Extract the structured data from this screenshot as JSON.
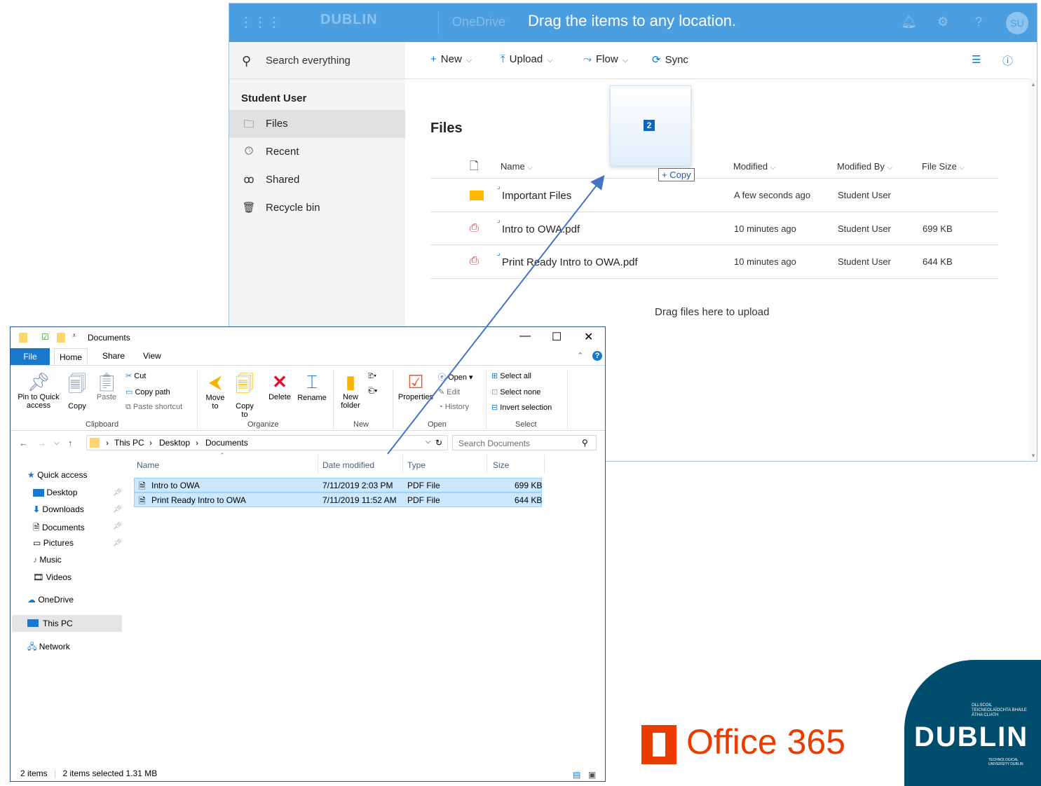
{
  "onedrive": {
    "brand": "DUBLIN",
    "app_name": "OneDrive",
    "message": "Drag the items to any location.",
    "avatar": "SU",
    "search_placeholder": "Search everything",
    "user_name": "Student User",
    "nav": [
      {
        "label": "Files",
        "icon": "folder-icon"
      },
      {
        "label": "Recent",
        "icon": "clock-icon"
      },
      {
        "label": "Shared",
        "icon": "people-icon"
      },
      {
        "label": "Recycle bin",
        "icon": "recycle-bin-icon"
      }
    ],
    "commands": {
      "new": "New",
      "upload": "Upload",
      "flow": "Flow",
      "sync": "Sync"
    },
    "files_title": "Files",
    "columns": {
      "name": "Name",
      "modified": "Modified",
      "modified_by": "Modified By",
      "file_size": "File Size"
    },
    "files": [
      {
        "name": "Important Files",
        "modified": "A few seconds ago",
        "by": "Student User",
        "size": "",
        "type": "folder"
      },
      {
        "name": "Intro to OWA.pdf",
        "modified": "10 minutes ago",
        "by": "Student User",
        "size": "699 KB",
        "type": "pdf"
      },
      {
        "name": "Print Ready Intro to OWA.pdf",
        "modified": "10 minutes ago",
        "by": "Student User",
        "size": "644 KB",
        "type": "pdf"
      }
    ],
    "drag_hint": "Drag files here to upload"
  },
  "drag": {
    "count": "2",
    "copy_label": "Copy"
  },
  "explorer": {
    "title": "Documents",
    "tabs": {
      "file": "File",
      "home": "Home",
      "share": "Share",
      "view": "View"
    },
    "ribbon": {
      "pin": "Pin to Quick access",
      "copy": "Copy",
      "paste": "Paste",
      "cut": "Cut",
      "copy_path": "Copy path",
      "paste_shortcut": "Paste shortcut",
      "clipboard": "Clipboard",
      "move_to": "Move to",
      "copy_to": "Copy to",
      "delete": "Delete",
      "rename": "Rename",
      "organize": "Organize",
      "new_folder": "New folder",
      "new": "New",
      "properties": "Properties",
      "open": "Open",
      "edit": "Edit",
      "history": "History",
      "open_group": "Open",
      "select_all": "Select all",
      "select_none": "Select none",
      "invert_selection": "Invert selection",
      "select": "Select"
    },
    "breadcrumb": [
      "This PC",
      "Desktop",
      "Documents"
    ],
    "search_placeholder": "Search Documents",
    "tree": {
      "quick_access": "Quick access",
      "desktop": "Desktop",
      "downloads": "Downloads",
      "documents": "Documents",
      "pictures": "Pictures",
      "music": "Music",
      "videos": "Videos",
      "onedrive": "OneDrive",
      "this_pc": "This PC",
      "network": "Network"
    },
    "columns": {
      "name": "Name",
      "date_modified": "Date modified",
      "type": "Type",
      "size": "Size"
    },
    "rows": [
      {
        "name": "Intro to OWA",
        "date": "7/11/2019 2:03 PM",
        "type": "PDF File",
        "size": "699 KB"
      },
      {
        "name": "Print Ready Intro to OWA",
        "date": "7/11/2019 11:52 AM",
        "type": "PDF File",
        "size": "644 KB"
      }
    ],
    "status": {
      "items": "2 items",
      "selected": "2 items selected  1.31 MB"
    }
  },
  "logos": {
    "office": "Office 365",
    "tud_word": "DUBLIN",
    "tud_irish": "OLLSCOIL TEICNEOLAÍOCHTA BHAILE ÁTHA CLIATH",
    "tud_english": "TECHNOLOGICAL UNIVERSITY DUBLIN"
  },
  "colors": {
    "onedrive_blue": "#4b9fe1",
    "accent": "#0078d4",
    "office_orange": "#eb3c00",
    "tud_navy": "#004d6e"
  }
}
